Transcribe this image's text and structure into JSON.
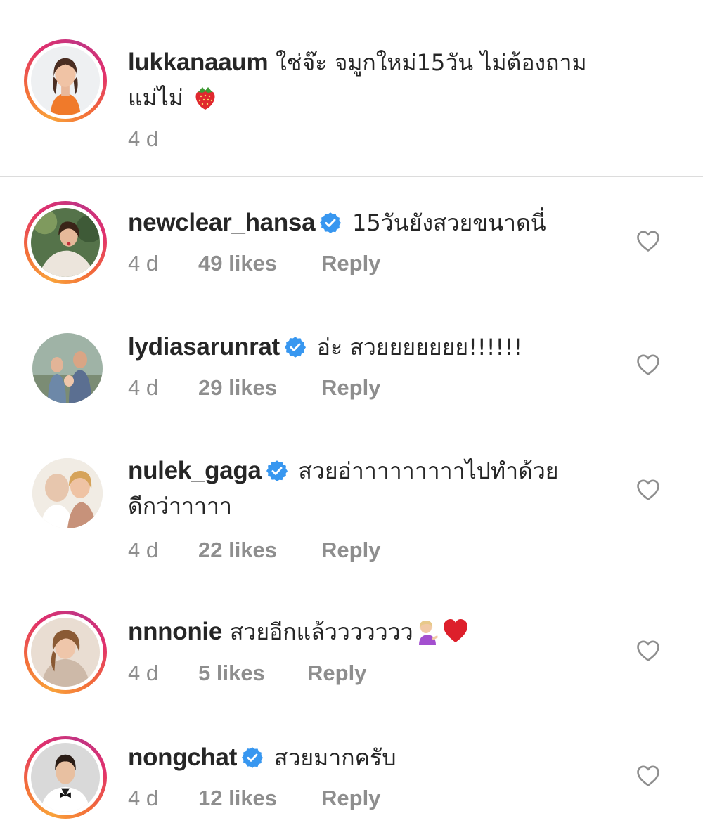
{
  "caption": {
    "username": "lukkanaaum",
    "text_line1": "ใช่จ๊ะ จมูกใหม่15วัน ไม่ต้องถาม",
    "text_line2": "แม่ไม่",
    "emoji": "strawberry-emoji",
    "time": "4 d"
  },
  "comments": [
    {
      "username": "newclear_hansa",
      "verified": true,
      "text": "15วันยังสวยขนาดนี่",
      "time": "4 d",
      "likes": "49 likes",
      "reply": "Reply"
    },
    {
      "username": "lydiasarunrat",
      "verified": true,
      "text": "อ่ะ สวยยยยยยย!!!!!!",
      "time": "4 d",
      "likes": "29 likes",
      "reply": "Reply"
    },
    {
      "username": "nulek_gaga",
      "verified": true,
      "text": "สวยอ่าาาาาาาาาไปทำด้วย",
      "text_line2": "ดีกว่าาาาา",
      "time": "4 d",
      "likes": "22 likes",
      "reply": "Reply"
    },
    {
      "username": "nnnonie",
      "verified": false,
      "text": "สวยอีกแล้ววววววว",
      "emojis": [
        "woman-tipping-hand-emoji",
        "red-heart-emoji"
      ],
      "time": "4 d",
      "likes": "5 likes",
      "reply": "Reply"
    },
    {
      "username": "nongchat",
      "verified": true,
      "text": "สวยมากครับ",
      "time": "4 d",
      "likes": "12 likes",
      "reply": "Reply"
    }
  ],
  "icons": {
    "verified": "verified-badge-icon",
    "like": "heart-outline-icon"
  },
  "colors": {
    "verified_blue": "#3897f0",
    "meta_gray": "#8e8e8e",
    "divider": "#dcdcdc",
    "text": "#262626"
  }
}
